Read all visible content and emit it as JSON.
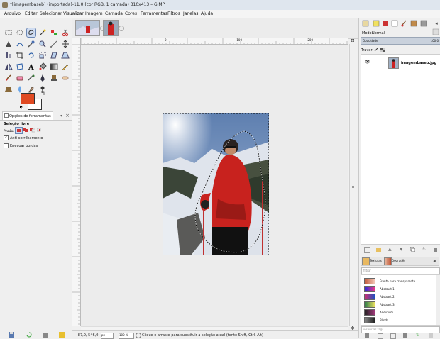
{
  "window": {
    "title": "*[imagembaseb] (importada)-11.0 (cor RGB, 1 camada) 310x413 – GIMP"
  },
  "menu": [
    "Arquivo",
    "Editar",
    "Selecionar",
    "Visualizar",
    "Imagem",
    "Camada",
    "Cores",
    "Ferramentas",
    "Filtros",
    "Janelas",
    "Ajuda"
  ],
  "toolbox": {
    "tool_options_tab": "Opções de ferramentas",
    "tool_name": "Seleção livre",
    "mode_label": "Modo:",
    "antialias_label": "Anti-serrilhamento",
    "feather_label": "Enevoar bordas",
    "antialias_checked": true,
    "feather_checked": false
  },
  "canvas": {
    "ruler_labels": [
      "0",
      "|100",
      "|200",
      "|300"
    ]
  },
  "status": {
    "coords": "-87,0, 546,0",
    "unit": "px",
    "zoom": "100 %",
    "message": "Clique e arraste para substituir a seleção atual (tente Shift, Ctrl, Alt)"
  },
  "layers": {
    "mode_label": "Modo:",
    "mode_value": "Normal",
    "opacity_label": "Opacidade",
    "opacity_value": "100,0",
    "lock_label": "Travar:",
    "layer_name": "imagembaseb.jpg"
  },
  "gradients": {
    "tab_textures": "Texturas",
    "tab_gradients": "Degradês",
    "filter_placeholder": "filtrar",
    "tag_placeholder": "inserir as tags",
    "items": [
      {
        "name": "Frente para transparente",
        "c1": "#c05a3a",
        "c2": "#f4c8b8"
      },
      {
        "name": "Abstract 1",
        "c1": "#2a2ad8",
        "c2": "#e83a8a"
      },
      {
        "name": "Abstract 2",
        "c1": "#d03070",
        "c2": "#2050c0"
      },
      {
        "name": "Abstract 3",
        "c1": "#2a7a4a",
        "c2": "#e8e060"
      },
      {
        "name": "Aneurism",
        "c1": "#202020",
        "c2": "#a03a7a"
      },
      {
        "name": "Blinds",
        "c1": "#888888",
        "c2": "#222222"
      }
    ]
  },
  "colors": {
    "accent": "#e04a22",
    "selection": "#cfdcf1"
  }
}
